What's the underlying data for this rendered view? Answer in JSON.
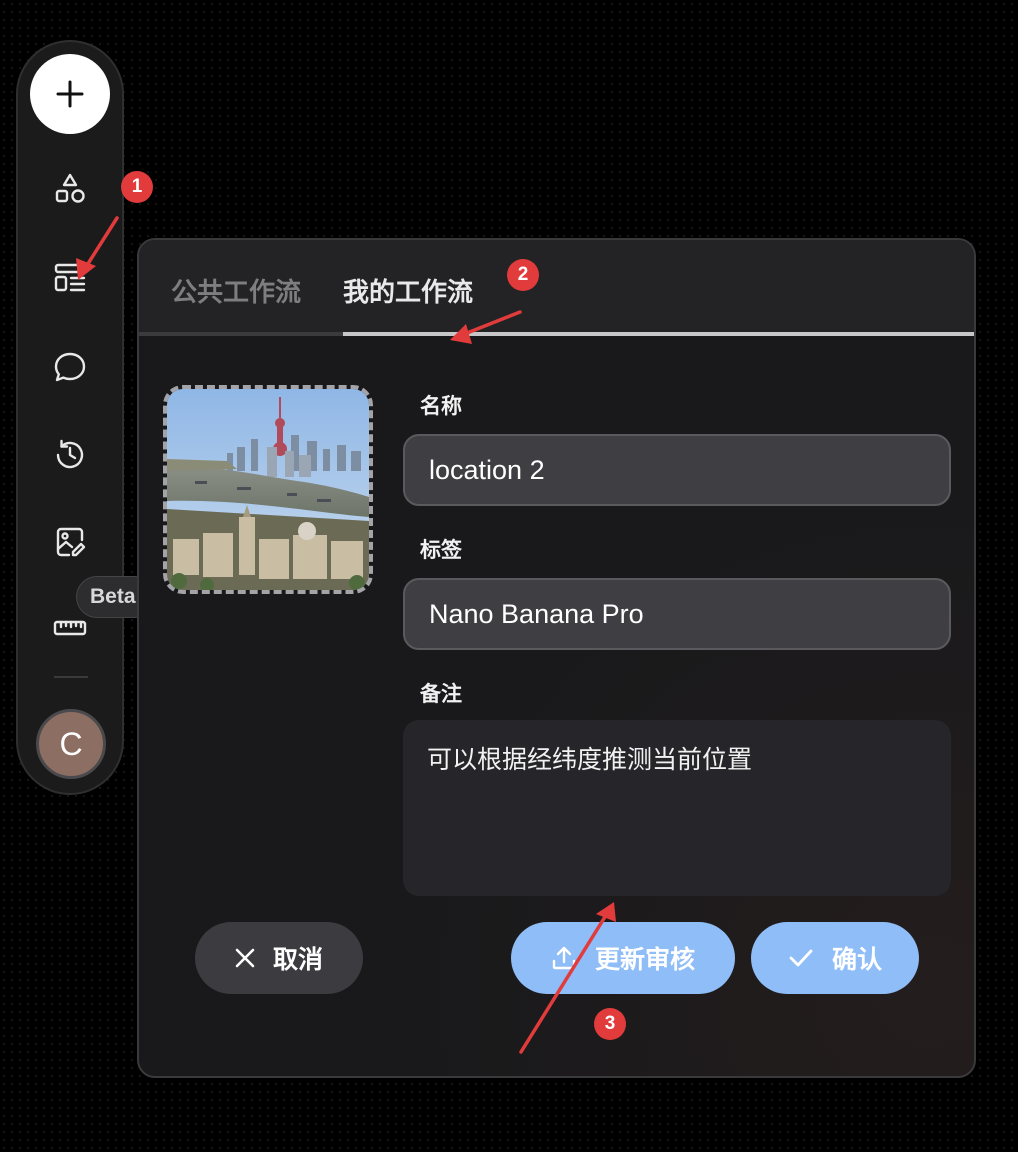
{
  "sidebar": {
    "items": [
      {
        "icon": "shapes-icon"
      },
      {
        "icon": "workflow-list-icon"
      },
      {
        "icon": "chat-icon"
      },
      {
        "icon": "history-icon"
      },
      {
        "icon": "image-edit-icon"
      },
      {
        "icon": "ruler-icon"
      }
    ],
    "beta_label": "Beta",
    "avatar_letter": "C"
  },
  "panel": {
    "tabs": [
      {
        "label": "公共工作流",
        "active": false
      },
      {
        "label": "我的工作流",
        "active": true
      }
    ],
    "form": {
      "name_label": "名称",
      "name_value": "location 2",
      "tag_label": "标签",
      "tag_value": "Nano Banana Pro",
      "note_label": "备注",
      "note_value": "可以根据经纬度推测当前位置"
    },
    "buttons": {
      "cancel": "取消",
      "update": "更新审核",
      "confirm": "确认"
    }
  },
  "annotations": [
    "1",
    "2",
    "3"
  ],
  "colors": {
    "accent": "#8fbdf7",
    "annotation": "#e23b3b",
    "panel_bg": "#19191b"
  }
}
